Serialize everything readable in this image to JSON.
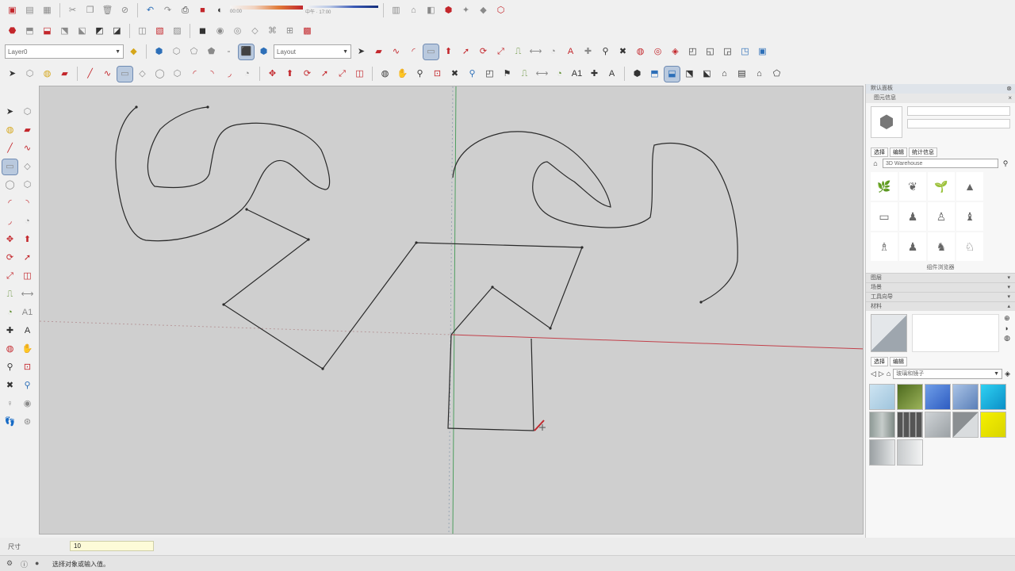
{
  "toolbar": {
    "layer_combo": "Layer0",
    "style_combo": "Layout",
    "shadow_scale_left": "00:00",
    "shadow_scale_mid": "中午",
    "shadow_scale_right": "17:00"
  },
  "tray": {
    "title": "默认面板",
    "sub_entity": "图元信息",
    "tab_select": "选择",
    "tab_edit": "编辑",
    "tab_stats": "统计信息",
    "components_search": "3D Warehouse",
    "components_footer": "组件浏览器",
    "sec_layers": "图层",
    "sec_scenes": "场景",
    "sec_tools": "工具向导",
    "sec_materials": "材料",
    "materials_tab_select": "选择",
    "materials_tab_edit": "编辑",
    "materials_combo": "玻璃和镜子"
  },
  "measure": {
    "label": "尺寸",
    "value": "10"
  },
  "status": {
    "hint": "选择对象或输入值。"
  },
  "colors": {
    "axis_red": "#c2404a",
    "axis_green": "#4f9e5f",
    "axis_blue": "#6c86c9",
    "edge": "#2a2a2a",
    "viewport_bg": "#cfcfcf"
  }
}
